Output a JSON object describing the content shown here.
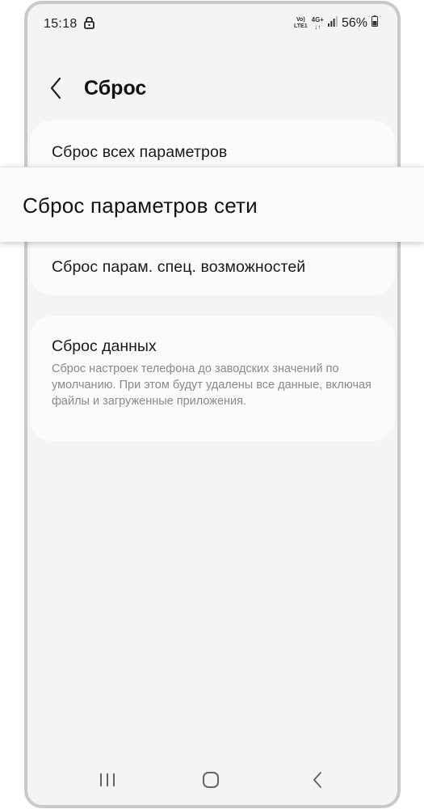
{
  "status_bar": {
    "time": "15:18",
    "network_volte": "Vo)\nLTE1",
    "network_type": "4G+",
    "battery_percent": "56%"
  },
  "header": {
    "title": "Сброс"
  },
  "reset_items": [
    "Сброс всех параметров",
    "Сброс параметров сети",
    "Сброс парам. спец. возможностей"
  ],
  "factory_reset": {
    "title": "Сброс данных",
    "description": "Сброс настроек телефона до заводских значений по умолчанию. При этом будут удалены все данные, включая файлы и загруженные приложения."
  },
  "icons": [
    "lock-icon",
    "signal-icon",
    "battery-icon",
    "chevron-left-icon",
    "recent-apps-icon",
    "home-icon",
    "back-icon"
  ]
}
